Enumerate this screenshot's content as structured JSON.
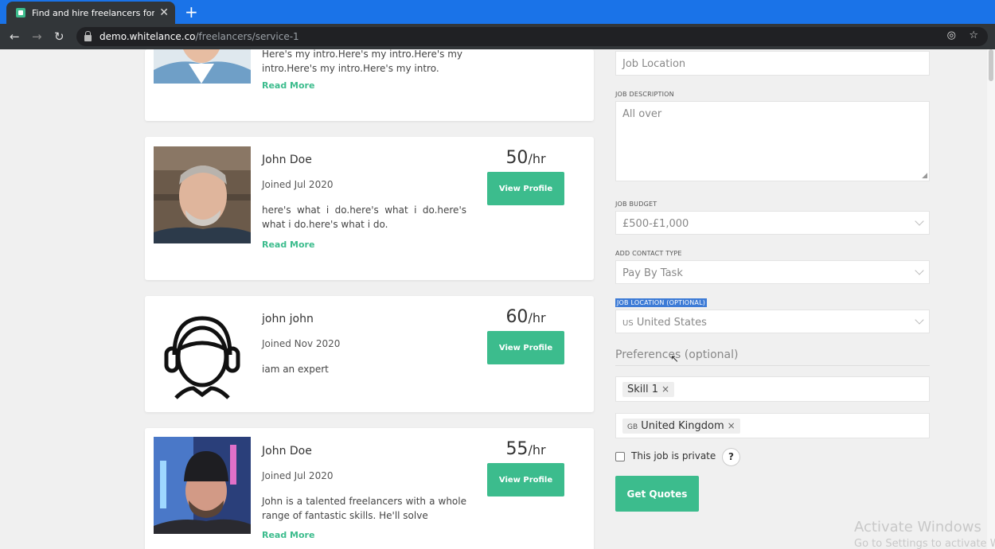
{
  "browser": {
    "tab_title": "Find and hire freelancers for your",
    "url_host": "demo.whitelance.co",
    "url_path": "/freelancers/service-1"
  },
  "freelancers": [
    {
      "intro_top": "Here's my intro.Here's my intro.Here's my",
      "intro_bottom": "intro.Here's my intro.Here's my intro.",
      "read_more": "Read More"
    },
    {
      "name": "John Doe",
      "joined": "Joined Jul 2020",
      "intro": "here's what i do.here's what i do.here's what i do.here's what i do.",
      "read_more": "Read More",
      "rate": "50",
      "rate_unit": "/hr",
      "view_profile": "View Profile"
    },
    {
      "name": "john john",
      "joined": "Joined Nov 2020",
      "intro": "iam an expert",
      "rate": "60",
      "rate_unit": "/hr",
      "view_profile": "View Profile"
    },
    {
      "name": "John Doe",
      "joined": "Joined Jul 2020",
      "intro": "John is a talented freelancers with a whole range of fantastic skills. He'll solve",
      "read_more": "Read More",
      "rate": "55",
      "rate_unit": "/hr",
      "view_profile": "View Profile"
    }
  ],
  "form": {
    "job_location_value": "Job Location",
    "job_description_label": "JOB DESCRIPTION",
    "job_description_value": "All over",
    "job_budget_label": "JOB BUDGET",
    "job_budget_value": "£500-£1,000",
    "contact_type_label": "ADD CONTACT TYPE",
    "contact_type_value": "Pay By Task",
    "location_optional_label": "JOB LOCATION (OPTIONAL)",
    "location_country_code": "US",
    "location_value": "United States",
    "preferences_label": "Preferences (optional)",
    "skill_chip": "Skill 1",
    "country_chip_code": "GB",
    "country_chip": "United Kingdom",
    "chip_remove": "×",
    "private_label": "This job is private",
    "help": "?",
    "submit": "Get Quotes"
  },
  "watermark": {
    "line1": "Activate Windows",
    "line2": "Go to Settings to activate W"
  }
}
